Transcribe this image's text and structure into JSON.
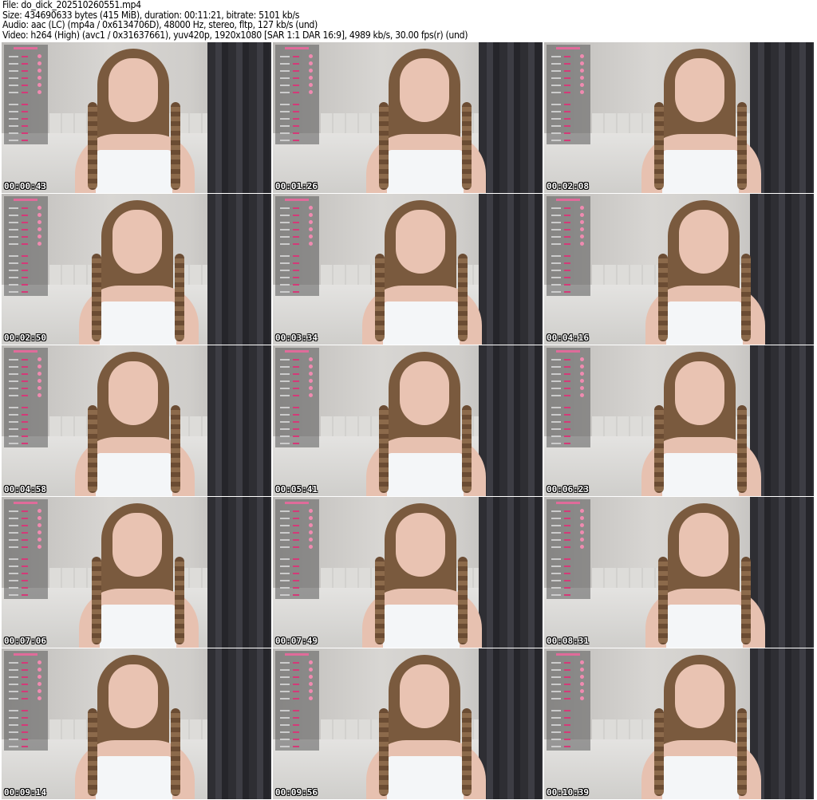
{
  "header": {
    "file": "File: do_dick_202510260551.mp4",
    "size": "Size: 434690633 bytes (415 MiB), duration: 00:11:21, bitrate: 5101 kb/s",
    "audio": "Audio: aac (LC) (mp4a / 0x6134706D), 48000 Hz, stereo, fltp, 127 kb/s (und)",
    "video": "Video: h264 (High) (avc1 / 0x31637661), yuv420p, 1920x1080 [SAR 1:1 DAR 16:9], 4989 kb/s, 30.00 fps(r) (und)"
  },
  "thumbnails": [
    {
      "timestamp": "00:00:43"
    },
    {
      "timestamp": "00:01:26"
    },
    {
      "timestamp": "00:02:08"
    },
    {
      "timestamp": "00:02:50"
    },
    {
      "timestamp": "00:03:34"
    },
    {
      "timestamp": "00:04:16"
    },
    {
      "timestamp": "00:04:58"
    },
    {
      "timestamp": "00:05:41"
    },
    {
      "timestamp": "00:06:23"
    },
    {
      "timestamp": "00:07:06"
    },
    {
      "timestamp": "00:07:49"
    },
    {
      "timestamp": "00:08:31"
    },
    {
      "timestamp": "00:09:14"
    },
    {
      "timestamp": "00:09:56"
    },
    {
      "timestamp": "00:10:39"
    }
  ]
}
